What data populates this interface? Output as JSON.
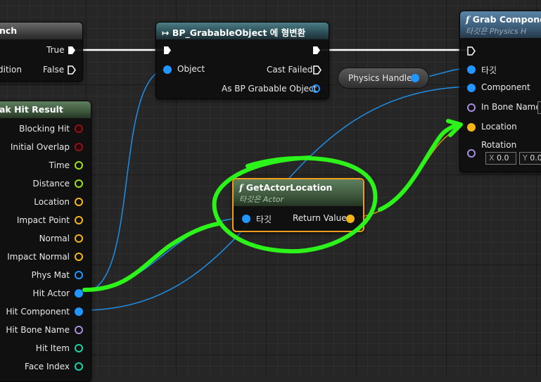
{
  "branch_node": {
    "title": "nch",
    "true_label": "True",
    "condition_label": "dition",
    "false_label": "False"
  },
  "cast_node": {
    "title": "BP_GrabableObject 에 형변환",
    "object_label": "Object",
    "cast_failed_label": "Cast Failed",
    "as_label": "As BP Grabable Object"
  },
  "physics_handle": {
    "label": "Physics Handle"
  },
  "grab_node": {
    "title": "Grab Componer",
    "subtitle_prefix": "타깃은",
    "subtitle_target": "Physics H",
    "pins": [
      "타깃",
      "Component",
      "In Bone Name",
      "Location",
      "Rotation"
    ],
    "rotation_x_label": "X",
    "rotation_x_value": "0.0",
    "rotation_y_label": "Y",
    "rotation_y_value": "0.0"
  },
  "break_hit_node": {
    "title": "ak Hit Result",
    "pins": [
      "Blocking Hit",
      "Initial Overlap",
      "Time",
      "Distance",
      "Location",
      "Impact Point",
      "Normal",
      "Impact Normal",
      "Phys Mat",
      "Hit Actor",
      "Hit Component",
      "Hit Bone Name",
      "Hit Item",
      "Face Index"
    ]
  },
  "get_actor_location_node": {
    "title": "GetActorLocation",
    "subtitle_prefix": "타깃은",
    "subtitle_target": "Actor",
    "target_label": "타깃",
    "return_label": "Return Value"
  },
  "colors": {
    "object_pin": "#2196ff",
    "vector_pin": "#f3b51d",
    "highlight": "#2cf31a",
    "selection": "#f29e1c"
  },
  "icons": {
    "function": "f-icon",
    "cast": "cast-arrow-icon",
    "exec": "exec-pin-icon"
  }
}
